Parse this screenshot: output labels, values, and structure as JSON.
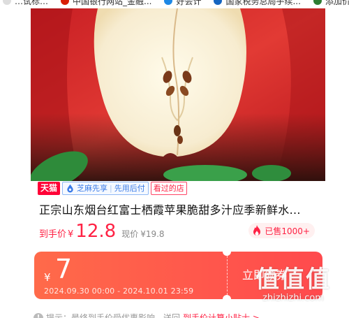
{
  "bookmarks": [
    {
      "label": "…试标…",
      "color": "#ffffff"
    },
    {
      "label": "中国银行网站_金融...",
      "color": "#d81e06"
    },
    {
      "label": "好会计",
      "color": "#1e88e5"
    },
    {
      "label": "国家税务总局手续...",
      "color": "#1565c0"
    },
    {
      "label": "添加价格",
      "color": "#2e7d32"
    }
  ],
  "product": {
    "tags": {
      "tmall": "天猫",
      "credit_part1": "芝麻先享",
      "credit_sep": "|",
      "credit_part2": "先用后付",
      "seen": "看过的店"
    },
    "title": "正宗山东烟台红富士栖霞苹果脆甜多汁应季新鲜水...",
    "price_label": "到手价",
    "currency": "¥",
    "price": "12.8",
    "orig_label": "现价",
    "orig_price": "¥19.8",
    "sold": "已售1000+"
  },
  "coupon": {
    "currency": "¥",
    "amount": "7",
    "dates": "2024.09.30 00:00 - 2024.10.01 23:59",
    "button": "立即领券"
  },
  "watermark": {
    "logo": "值值值",
    "url": "zhizhizhi.com"
  },
  "tip": {
    "icon": "!",
    "text": "提示：最终到手价受优惠影响，送回",
    "link": "到手价计算小贴士 >"
  },
  "colors": {
    "accent": "#ff2244",
    "coupon_bg": "#ff5a4c",
    "tmall": "#ff0036",
    "credit_blue": "#3a7be8"
  }
}
